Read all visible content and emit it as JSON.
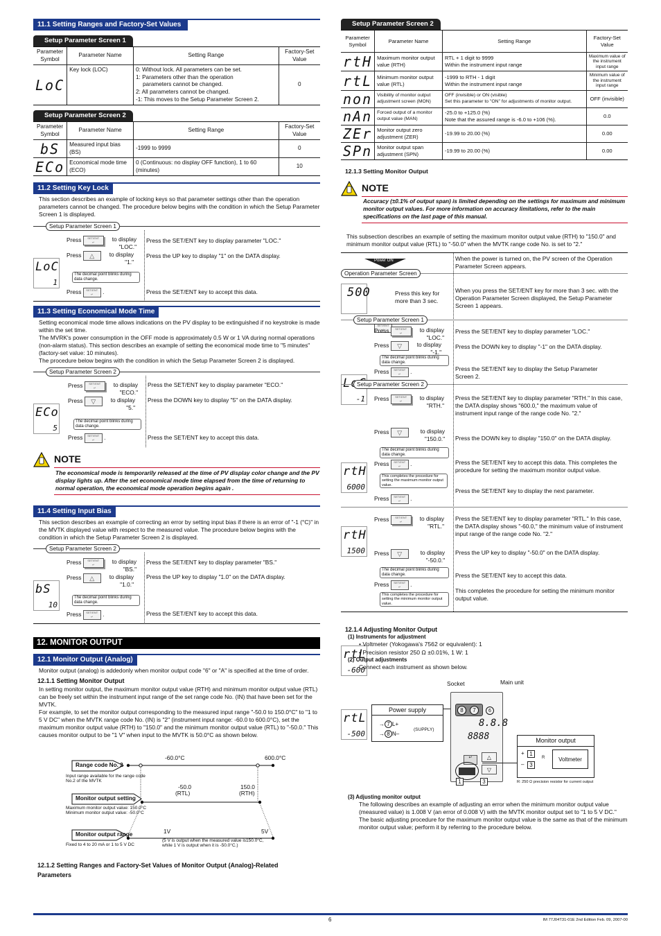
{
  "left": {
    "s11_1": {
      "title": "11.1  Setting Ranges and Factory-Set Values",
      "screen1": {
        "tab": "Setup Parameter Screen 1",
        "headers": [
          "Parameter Symbol",
          "Parameter Name",
          "Setting Range",
          "Factory-Set Value"
        ],
        "rows": [
          {
            "symbol": "LoC",
            "name": "Key lock (LOC)",
            "range": [
              "0: Without lock.  All parameters can be set.",
              "1: Parameters other than the operation",
              "    parameters cannot be changed.",
              "2: All parameters cannot be changed.",
              "-1: This moves to the Setup Parameter Screen 2."
            ],
            "value": "0"
          }
        ]
      },
      "screen2": {
        "tab": "Setup Parameter Screen 2",
        "headers": [
          "Parameter Symbol",
          "Parameter Name",
          "Setting Range",
          "Factory-Set Value"
        ],
        "rows": [
          {
            "symbol": "bS",
            "name": "Measured input bias (BS)",
            "range": "-1999 to 9999",
            "value": "0"
          },
          {
            "symbol": "ECo",
            "name": "Economical mode time (ECO)",
            "range": "0 (Continuous: no display OFF function), 1 to 60 (minutes)",
            "value": "10"
          }
        ]
      }
    },
    "s11_2": {
      "title": "11.2  Setting Key Lock",
      "intro": "This section describes an example of locking keys so that parameter settings other than the operation parameters cannot be changed.   The procedure below begins with the condition in which the Setup Parameter Screen 1 is displayed.",
      "screen_label": "Setup Parameter Screen 1",
      "lcd_top": "LoC",
      "lcd_bot": "1",
      "steps": [
        {
          "press": "Press",
          "display": "to display \"LOC.\"",
          "desc": "Press the SET/ENT key to display parameter \"LOC.\""
        },
        {
          "press": "Press",
          "display": "to display \"1.\"",
          "desc": "Press the UP key to display \"1\" on the DATA display."
        },
        {
          "press": "Press",
          "display": ".",
          "desc": "Press the SET/ENT key to accept this data."
        }
      ],
      "blink_note": "The decimal point blinks during data change."
    },
    "s11_3": {
      "title": "11.3  Setting Economical Mode Time",
      "intro": [
        "Setting economical mode time allows indications on the PV display to be extinguished if no keystroke is made within the set time.",
        "The MVRK's power consumption in the OFF mode is approximately 0.5 W or 1 VA during normal operations (non-alarm status).  This section describes an example of setting the economical mode time to \"5 minutes\" (factory-set value: 10 minutes).",
        "The procedure below begins with the condition in which the Setup Parameter Screen 2 is displayed."
      ],
      "screen_label": "Setup Parameter Screen 2",
      "lcd_top": "ECo",
      "lcd_bot": "5",
      "steps": [
        {
          "press": "Press",
          "display": "to display \"ECO.\"",
          "desc": "Press the SET/ENT key to display parameter \"ECO.\""
        },
        {
          "press": "Press",
          "display": "to display \"5.\"",
          "desc": "Press the DOWN key to display \"5\" on the DATA display."
        },
        {
          "press": "Press",
          "display": ".",
          "desc": "Press the SET/ENT key to accept this data."
        }
      ],
      "blink_note": "The decimal point blinks during data change."
    },
    "note1": {
      "title": "NOTE",
      "body": "The economical mode is temporarily released at the time of PV display color change and the PV display lights up.  After the set economical mode time elapsed from the time of returning to normal operation, the economical mode operation begins again ."
    },
    "s11_4": {
      "title": "11.4  Setting Input Bias",
      "intro": "This section describes an example of correcting an error by setting input bias if there is an error of \"-1 (°C)\" in the MVTK displayed value with respect to the measured value.  The procedure below begins with the condition in which the Setup Parameter Screen 2 is displayed.",
      "screen_label": "Setup Parameter Screen 2",
      "lcd_top": "bS",
      "lcd_bot": "10",
      "steps": [
        {
          "press": "Press",
          "display": "to display \"BS.\"",
          "desc": "Press the SET/ENT key to display parameter \"BS.\""
        },
        {
          "press": "Press",
          "display": "to display \"1.0.\"",
          "desc": "Press the UP key to display \"1.0\" on the DATA display."
        },
        {
          "press": "Press",
          "display": ".",
          "desc": "Press the SET/ENT key to accept this data."
        }
      ],
      "blink_note": "The decimal point blinks during data change."
    },
    "s12": {
      "title": "12. MONITOR OUTPUT",
      "s12_1_title": "12.1  Monitor Output (Analog)",
      "s12_1_text": "Monitor output (analog) is addedonly when monitor output code \"6\" or \"A\" is specified at the time of order.",
      "s12_1_1_title": "12.1.1    Setting Monitor Output",
      "s12_1_1_text": [
        "In setting monitor output, the maximum monitor output value (RTH) and minimum monitor output value (RTL) can be freely set within the instrument input range of the set range code No. (IN) that have been set for the MVTK.",
        "For example, to set the monitor output corresponding to the measured input range \"-50.0 to 150.0°C\" to \"1 to 5 V DC\" when the MVTK range code No. (IN) is \"2\" (instrument input range: -60.0 to 600.0°C), set the maximum monitor output value (RTH) to \"150.0\" and the minimum monitor output value (RTL) to \"-50.0.\"  This causes monitor output to be \"1 V\" when input to the MVTK is 50.0°C as shown below."
      ],
      "diagram": {
        "range_box": "Range code No. 2",
        "range_caption": "Input range available for the range code No.2 of the MVTK",
        "range_min": "-60.0°C",
        "range_max": "600.0°C",
        "setting_box": "Monitor output setting",
        "setting_caption": [
          "Maximum monitor output value: 150.0°C",
          "Minimum monitor output value:  -50.0°C"
        ],
        "rtl_val": "-50.0",
        "rtl_lbl": "(RTL)",
        "rth_val": "150.0",
        "rth_lbl": "(RTH)",
        "out_box": "Monitor output range",
        "out_caption": "Fixed to 4 to 20 mA or 1 to 5 V DC",
        "v_low": "1V",
        "v_high": "5V",
        "out_note": [
          "(5 V is output when the measured value is150.0°C,",
          "while 1 V is output when it is -50.0°C.)"
        ]
      },
      "s12_1_2_title": "12.1.2    Setting Ranges and Factory-Set Values of Monitor Output (Analog)-Related Parameters"
    }
  },
  "right": {
    "screen2": {
      "tab": "Setup Parameter Screen 2",
      "headers": [
        "Parameter Symbol",
        "Parameter Name",
        "Setting Range",
        "Factory-Set Value"
      ],
      "rows": [
        {
          "symbol": "rtH",
          "name": "Maximum monitor output value (RTH)",
          "range": [
            "RTL + 1 digit to 9999",
            "Within the instrument input range"
          ],
          "value": "Maximum value of the instrument input range"
        },
        {
          "symbol": "rtL",
          "name": "Minimum monitor output value (RTL)",
          "range": [
            "-1999 to RTH - 1 digit",
            "Within the instrument input range"
          ],
          "value": "Minimum value of the instrument input range"
        },
        {
          "symbol": "non",
          "name": "Visibility of monitor output adjustment screen (MON)",
          "range": [
            "OFF (invisible) or ON (visible)",
            "Set this parameter to \"ON\" for adjustments of monitor output."
          ],
          "value": "OFF (invisible)"
        },
        {
          "symbol": "nAn",
          "name": "Forced output of a monitor output value (MAN)",
          "range": [
            "-25.0 to +125.0 (%)",
            "Note that the assured range is -6.0 to +106 (%)."
          ],
          "value": "0.0"
        },
        {
          "symbol": "ZEr",
          "name": "Monitor output zero adjustment (ZER)",
          "range": [
            "-19.99 to 20.00 (%)"
          ],
          "value": "0.00"
        },
        {
          "symbol": "SPn",
          "name": "Monitor output span adjustment (SPN)",
          "range": [
            "-19.99 to 20.00 (%)"
          ],
          "value": "0.00"
        }
      ]
    },
    "s12_1_3": {
      "title": "12.1.3    Setting Monitor Output",
      "note_title": "NOTE",
      "note_body": "Accuracy (±0.1% of output span) is limited depending on the settings for maximum and minimum monitor output values.  For more information on accuracy limitations, refer to the main specifications on the last page of this manual.",
      "intro": "This subsection describes an example of setting the maximum monitor output value (RTH) to \"150.0\" and minimum monitor output value (RTL) to \"-50.0\" when the MVTK range code No. is set to \"2.\"",
      "power_on": "Power ON",
      "power_on_desc": "When the power is turned on, the PV screen of the Operation Parameter Screen appears.",
      "op_screen": "Operation Parameter Screen",
      "op_lcd": "500",
      "op_press": "Press this key for more than 3 sec.",
      "op_desc": "When you press the SET/ENT key for more than 3 sec. with the Operation Parameter Screen displayed, the Setup Parameter Screen 1 appears.",
      "sps1": "Setup Parameter Screen 1",
      "loc_steps": [
        {
          "press": "Press",
          "display": "to display \"LOC.\"",
          "desc": "Press the SET/ENT key to display parameter \"LOC.\""
        },
        {
          "press": "Press",
          "display": "to display \"-1.\"",
          "desc": "Press the DOWN key to display \"-1\" on the DATA display."
        },
        {
          "press": "Press",
          "display": ".",
          "desc": "Press the SET/ENT key to display the Setup Parameter Screen 2."
        }
      ],
      "sps2": "Setup Parameter Screen 2",
      "rth_steps": [
        {
          "lcd_top": "rtH",
          "lcd_bot": "6000",
          "press": "Press",
          "display": "to display \"RTH.\"",
          "desc": "Press the SET/ENT key to display parameter \"RTH.\" In this case, the DATA display shows \"600.0,\" the maximum value of instrument input range of the range code No.  \"2.\""
        },
        {
          "lcd_top": "rtH",
          "lcd_bot": "1500",
          "press": "Press",
          "display": "to display \"150.0.\"",
          "desc": "Press the DOWN key to display \"150.0\" on the DATA display."
        },
        {
          "press": "Press",
          "display": ".",
          "desc": "Press the SET/ENT key to accept this data. This completes the procedure for setting the maximum monitor output value."
        },
        {
          "press": "Press",
          "display": ".",
          "desc": "Press the SET/ENT key to display the next parameter."
        }
      ],
      "rth_complete": "This completes the procedure for setting the maximum monitor output value.",
      "rtl_steps": [
        {
          "lcd_top": "rtL",
          "lcd_bot": "-600",
          "press": "Press",
          "display": "to display \"RTL.\"",
          "desc": "Press the SET/ENT key to display parameter \"RTL.\" In this case, the DATA display shows \"-60.0,\" the minimum value of instrument input range of the range code No. \"2.\""
        },
        {
          "lcd_top": "rtL",
          "lcd_bot": "-500",
          "press": "Press",
          "display": "to display \"-50.0.\"",
          "desc": "Press the UP key to display \"-50.0\" on the DATA display."
        },
        {
          "press": "Press",
          "display": ".",
          "desc": "Press the SET/ENT key to accept this data."
        },
        {
          "desc": "This completes the procedure for setting the minimum monitor output value."
        }
      ],
      "rtl_complete": "This completes the procedure for setting the minimum monitor output value.",
      "blink_note": "The decimal point blinks during data change."
    },
    "s12_1_4": {
      "title": "12.1.4    Adjusting Monitor Output",
      "item1_title": "(1)  Instruments for adjustment",
      "item1_list": [
        "• Voltmeter (Yokogawa's 7562 or equivalent): 1",
        "• Precision resistor 250 Ω ±0.01%, 1 W: 1"
      ],
      "item2_title": "(2)  Output adjustments",
      "item2_text": "Connect each instrument as shown below.",
      "wiring": {
        "socket": "Socket",
        "main_unit": "Main unit",
        "power_supply": "Power supply",
        "l_plus": "L+",
        "n_minus": "N–",
        "supply": "(SUPPLY)",
        "term7": "7",
        "term8": "8",
        "term6": "6",
        "monitor_output": "Monitor output",
        "plus": "+",
        "minus": "–",
        "t1": "1",
        "t3": "3",
        "r": "R",
        "voltmeter": "Voltmeter",
        "r_note": "R: 250 Ω precision resistor for current output"
      },
      "item3_title": "(3)  Adjusting monitor output",
      "item3_text": "The following describes an example of adjusting an error when the minimum monitor output value (measured value) is 1.008 V (an error of 0.008 V) with the MVTK monitor output set to \"1 to 5 V DC.\"  The basic adjusting procedure for the maximum monitor output value is the same as that of the minimum monitor output value; perform it by referring to the procedure below."
    }
  },
  "footer": {
    "page": "6",
    "doc": "IM 77J04T31-01E  2nd Edition  Feb. 09, 2007-00"
  }
}
